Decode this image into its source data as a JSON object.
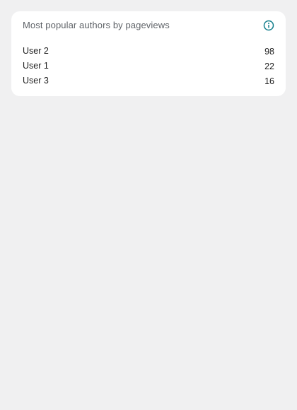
{
  "colors": {
    "page_background": "#f0f0f1",
    "card_background": "#ffffff",
    "accent": "#137e8c"
  },
  "card": {
    "title": "Most popular authors by pageviews",
    "icon": "info-circle-icon",
    "rows": [
      {
        "name": "User 2",
        "value": "98"
      },
      {
        "name": "User 1",
        "value": "22"
      },
      {
        "name": "User 3",
        "value": "16"
      }
    ]
  }
}
